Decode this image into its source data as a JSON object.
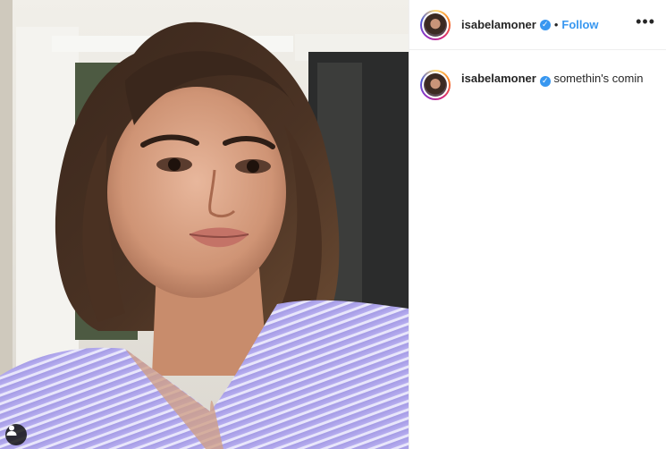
{
  "post": {
    "username": "isabelamoner",
    "follow_label": "Follow",
    "separator": "•",
    "more_label": "•••",
    "caption": "somethin's comin"
  },
  "icons": {
    "verified": "verified-badge-icon",
    "more": "more-options-icon",
    "tag": "user-tag-icon"
  },
  "colors": {
    "accent": "#3897f0",
    "text": "#262626",
    "border": "#efefef"
  }
}
